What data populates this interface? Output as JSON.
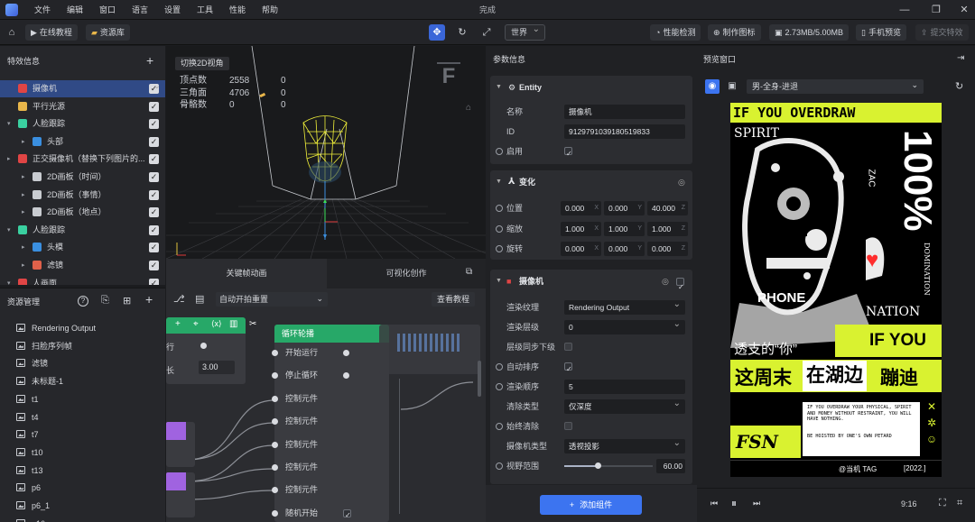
{
  "menubar": {
    "items": [
      "文件",
      "编辑",
      "窗口",
      "语言",
      "设置",
      "工具",
      "性能",
      "帮助"
    ],
    "title": "完成"
  },
  "toolbar": {
    "online_tutorial": "在线教程",
    "asset_library": "资源库",
    "space_select": "世界",
    "perf_check": "性能检测",
    "make_icon": "制作图标",
    "memory": "2.73MB/5.00MB",
    "phone_preview": "手机预览",
    "submit_effect": "提交特效"
  },
  "effects_panel": {
    "title": "特效信息",
    "items": [
      {
        "label": "摄像机",
        "level": 0,
        "icon": "camera-icon",
        "selected": true
      },
      {
        "label": "平行光源",
        "level": 0,
        "icon": "light-icon"
      },
      {
        "label": "人脸跟踪",
        "level": 0,
        "icon": "face-track-icon"
      },
      {
        "label": "头部",
        "level": 1,
        "icon": "cube-icon"
      },
      {
        "label": "正交摄像机（替换下列图片的...",
        "level": 0,
        "icon": "camera-icon"
      },
      {
        "label": "2D画板（时间）",
        "level": 1,
        "icon": "board-icon"
      },
      {
        "label": "2D画板（事情）",
        "level": 1,
        "icon": "board-icon"
      },
      {
        "label": "2D画板（地点）",
        "level": 1,
        "icon": "board-icon"
      },
      {
        "label": "人脸跟踪",
        "level": 0,
        "icon": "face-track-icon"
      },
      {
        "label": "头模",
        "level": 1,
        "icon": "cube-icon"
      },
      {
        "label": "滤镜",
        "level": 1,
        "icon": "filter-icon"
      },
      {
        "label": "人画面",
        "level": 0,
        "icon": "camera-icon"
      }
    ]
  },
  "assets_panel": {
    "title": "资源管理",
    "items": [
      "Rendering Output",
      "扫脸序列帧",
      "滤镜",
      "未标题-1",
      "t1",
      "t4",
      "t7",
      "t10",
      "t13",
      "p6",
      "p6_1",
      "p16"
    ]
  },
  "viewport": {
    "switch_2d": "切换2D视角",
    "stats": [
      {
        "label": "顶点数",
        "a": "2558",
        "b": "0"
      },
      {
        "label": "三角面",
        "a": "4706",
        "b": "0"
      },
      {
        "label": "骨骼数",
        "a": "0",
        "b": "0"
      }
    ],
    "gizmo_label": "F"
  },
  "tabs": {
    "keyframe": "关键帧动画",
    "visual": "可视化创作"
  },
  "node_editor": {
    "trigger_select": "自动开拍重置",
    "view_tutorial": "查看教程",
    "left_node": {
      "row1": "行",
      "row2_label": "长",
      "row2_value": "3.00"
    },
    "loop_node": {
      "title": "循环轮播",
      "ports": [
        "开始运行",
        "停止循环",
        "控制元件",
        "控制元件",
        "控制元件",
        "控制元件",
        "控制元件",
        "随机开始"
      ]
    }
  },
  "params": {
    "title": "参数信息",
    "entity": {
      "header": "Entity",
      "name_label": "名称",
      "name_value": "摄像机",
      "id_label": "ID",
      "id_value": "9129791039180519833",
      "enable_label": "启用"
    },
    "transform": {
      "header": "变化",
      "rows": [
        {
          "label": "位置",
          "x": "0.000",
          "y": "0.000",
          "z": "40.000"
        },
        {
          "label": "缩放",
          "x": "1.000",
          "y": "1.000",
          "z": "1.000"
        },
        {
          "label": "旋转",
          "x": "0.000",
          "y": "0.000",
          "z": "0.000"
        }
      ],
      "axes": [
        "X",
        "Y",
        "Z"
      ]
    },
    "camera": {
      "header": "摄像机",
      "render_texture_label": "渲染纹理",
      "render_texture_value": "Rendering Output",
      "render_layer_label": "渲染层级",
      "render_layer_value": "0",
      "layer_sync_label": "层级同步下级",
      "auto_sort_label": "自动排序",
      "render_order_label": "渲染顺序",
      "render_order_value": "5",
      "clear_type_label": "清除类型",
      "clear_type_value": "仅深度",
      "always_clear_label": "始终清除",
      "camera_type_label": "摄像机类型",
      "camera_type_value": "透视投影",
      "fov_label": "视野范围",
      "fov_value": "60.00",
      "fov_fraction": 0.38
    },
    "add_component": "添加组件"
  },
  "preview": {
    "title": "预览窗口",
    "scene_select": "男-全身-进退",
    "ratio": "9:16",
    "poster": {
      "top_banner": "IF YOU OVERDRAW",
      "spirit": "SPIRIT",
      "percent": "100%",
      "zac": "ZAC",
      "domination": "DOMINATION",
      "phone": "PHONE",
      "nation": "NATION",
      "you_text": "透支的“你”",
      "if_you": "IF YOU",
      "weekend": "这周末",
      "lake": "在湖边",
      "dance": "蹦迪",
      "body1": "IF YOU OVERDRAW YOUR PHYSICAL, SPIRIT AND MONEY WITHOUT RESTRAINT, YOU WILL HAVE NOTHING.",
      "body2": "BE HOISTED BY ONE'S OWN PETARD",
      "year": "[2022.]",
      "footer_small": "@当机 TAG",
      "colors": {
        "accent": "#d9f230",
        "heart": "#ff2d2d"
      }
    }
  }
}
